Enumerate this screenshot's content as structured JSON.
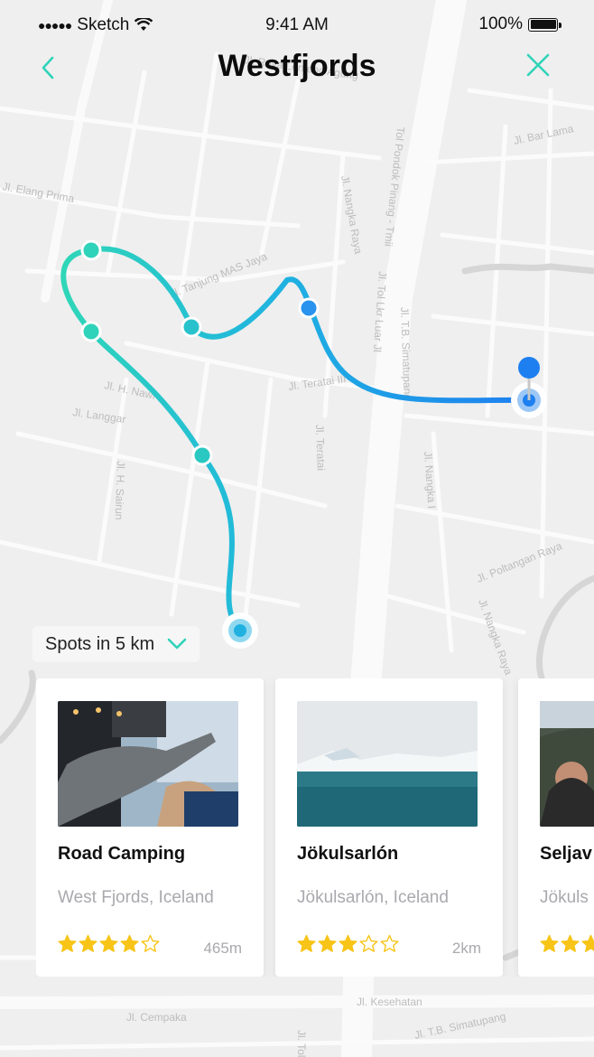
{
  "status_bar": {
    "carrier": "Sketch",
    "time": "9:41 AM",
    "battery": "100%"
  },
  "nav": {
    "title": "Westfjords"
  },
  "map": {
    "streets": [
      "Jl. Tanjung MAS Jaya",
      "Jl. Nangka Raya",
      "Tol Pondok Pinang - Tmii",
      "Jl. Tol Lkr Luar Jl",
      "Jl. T.B. Simatupang",
      "Jl. Teratai III",
      "Jl. Teratai",
      "Jl. Langgar",
      "Jl. Elang Prima",
      "Jl. Nangka I",
      "Jl. Poltangan Raya",
      "Jl. Nangka Raya",
      "Jl. Kesehatan",
      "Jl. Cempaka",
      "Jl. T.B. Simatupang",
      "Jl. Tol",
      "Jl. Raya Lenteng Agung",
      "Jl. H. Sairun",
      "Jl. Bar Lama",
      "Jl. H. Nawi"
    ]
  },
  "filter": {
    "label": "Spots in 5 km"
  },
  "cards": [
    {
      "name": "Road Camping",
      "location": "West Fjords, Iceland",
      "rating": 4,
      "distance": "465m"
    },
    {
      "name": "Jökulsarlón",
      "location": "Jökulsarlón, Iceland",
      "rating": 3,
      "distance": "2km"
    },
    {
      "name": "Seljav",
      "location": "Jökuls",
      "rating": 3,
      "distance": ""
    }
  ],
  "colors": {
    "accent_teal": "#2fd3b9",
    "accent_blue": "#1e7ff0",
    "star": "#f7c417",
    "star_empty": "#f7c417"
  }
}
